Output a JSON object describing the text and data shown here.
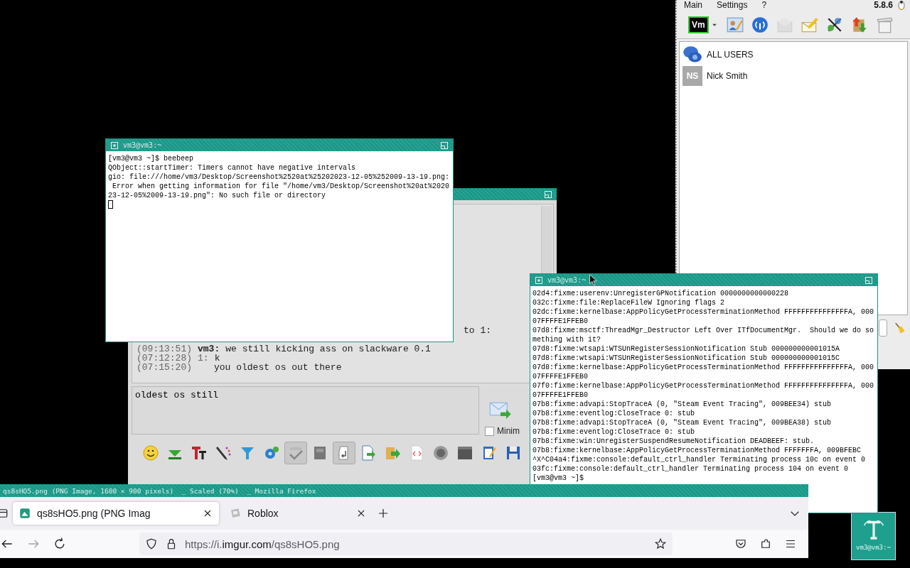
{
  "beebeep": {
    "menu": [
      "Main",
      "Settings",
      "?"
    ],
    "version": "5.8.6",
    "logo": "Vm",
    "toolbar": [
      {
        "kind": "caret",
        "disabled": false
      },
      {
        "kind": "profile",
        "disabled": false
      },
      {
        "kind": "network",
        "disabled": false
      },
      {
        "kind": "mail",
        "disabled": true
      },
      {
        "kind": "mail-edit",
        "disabled": false
      },
      {
        "kind": "tools",
        "disabled": false
      },
      {
        "kind": "transfer",
        "disabled": false
      },
      {
        "kind": "bin",
        "disabled": false
      }
    ],
    "users": [
      {
        "kind": "group",
        "name": "ALL USERS"
      },
      {
        "kind": "user",
        "initials": "NS",
        "name": "Nick Smith"
      }
    ]
  },
  "terminal_1": {
    "title": "vm3@vm3:~",
    "cursor": true,
    "lines": [
      "[vm3@vm3 ~]$ beebeep",
      "QObject::startTimer: Timers cannot have negative intervals",
      "gio: file:///home/vm3/Desktop/Screenshot%2520at%25202023-12-05%252009-13-19.png:",
      " Error when getting information for file \"/home/vm3/Desktop/Screenshot%20at%2020",
      "23-12-05%2009-13-19.png\": No such file or directory"
    ]
  },
  "chat": {
    "partial_line": "to 1:",
    "messages": [
      {
        "kind": "own",
        "time": "(09:13:51)",
        "author": "vm3:",
        "text": "we still kicking ass on slackware 0.1"
      },
      {
        "kind": "peer",
        "time": "(07:12:28)",
        "author": "1:",
        "text": "k"
      },
      {
        "kind": "continuation",
        "time": "(07:15:20)",
        "text": "you oldest os out there"
      }
    ],
    "input": "oldest os still",
    "minimize_label": "Minim",
    "minimize_checked": false,
    "toolbar": [
      {
        "kind": "smiley",
        "pressed": false
      },
      {
        "kind": "down",
        "pressed": false
      },
      {
        "kind": "font",
        "pressed": false
      },
      {
        "kind": "pencil",
        "pressed": false
      },
      {
        "kind": "funnel",
        "pressed": false
      },
      {
        "kind": "gears",
        "pressed": false
      },
      {
        "kind": "check",
        "pressed": true
      },
      {
        "kind": "book",
        "pressed": false
      },
      {
        "kind": "return",
        "pressed": true
      },
      {
        "kind": "doc",
        "pressed": false
      },
      {
        "kind": "folder",
        "pressed": false
      },
      {
        "kind": "code",
        "pressed": false
      },
      {
        "kind": "disc",
        "pressed": false
      },
      {
        "kind": "window",
        "pressed": false
      },
      {
        "kind": "note",
        "pressed": false
      },
      {
        "kind": "disk",
        "pressed": false
      }
    ]
  },
  "terminal_2": {
    "title": "vm3@vm3:~",
    "lines": [
      "02d4:fixme:userenv:UnregisterGPNotification 0000000000000228",
      "032c:fixme:file:ReplaceFileW Ignoring flags 2",
      "02dc:fixme:kernelbase:AppPolicyGetProcessTerminationMethod FFFFFFFFFFFFFFFA, 000",
      "07FFFFE1FFEB0",
      "07d8:fixme:msctf:ThreadMgr_Destructor Left Over ITfDocumentMgr.  Should we do so",
      "mething with it?",
      "07d8:fixme:wtsapi:WTSUnRegisterSessionNotification Stub 000000000001015A",
      "07d8:fixme:wtsapi:WTSUnRegisterSessionNotification Stub 000000000001015C",
      "07d8:fixme:kernelbase:AppPolicyGetProcessTerminationMethod FFFFFFFFFFFFFFFA, 000",
      "07FFFFE1FFEB0",
      "07f0:fixme:kernelbase:AppPolicyGetProcessTerminationMethod FFFFFFFFFFFFFFFA, 000",
      "07FFFFE1FFEB0",
      "07b8:fixme:advapi:StopTraceA (0, \"Steam Event Tracing\", 009BEE34) stub",
      "07b8:fixme:eventlog:CloseTrace 0: stub",
      "07b8:fixme:advapi:StopTraceA (0, \"Steam Event Tracing\", 009BEA38) stub",
      "07b8:fixme:eventlog:CloseTrace 0: stub",
      "07b8:fixme:win:UnregisterSuspendResumeNotification DEADBEEF: stub.",
      "07b8:fixme:kernelbase:AppPolicyGetProcessTerminationMethod FFFFFFFA, 009BFEBC",
      "^X^C04a4:fixme:console:default_ctrl_handler Terminating process 10c on event 0",
      "03fc:fixme:console:default_ctrl_handler Terminating process 104 on event 0",
      "[vm3@vm3 ~]$"
    ]
  },
  "firefox": {
    "title": "qs8sHO5.png (PNG Image, 1600 × 900 pixels)  _ Scaled (70%)  _ Mozilla Firefox",
    "tabs": [
      {
        "kind": "image",
        "label": "qs8sHO5.png (PNG Imag",
        "selected": true
      },
      {
        "kind": "page",
        "label": "Roblox",
        "selected": false
      }
    ],
    "nav": [
      {
        "kind": "back",
        "disabled": false
      },
      {
        "kind": "forward",
        "disabled": true
      },
      {
        "kind": "reload",
        "disabled": false
      }
    ],
    "url": {
      "scheme": "https://i.",
      "domain": "imgur.com",
      "path": "/qs8sHO5.png"
    }
  },
  "desktop_icon": {
    "label": "vm3@vm3:~"
  }
}
